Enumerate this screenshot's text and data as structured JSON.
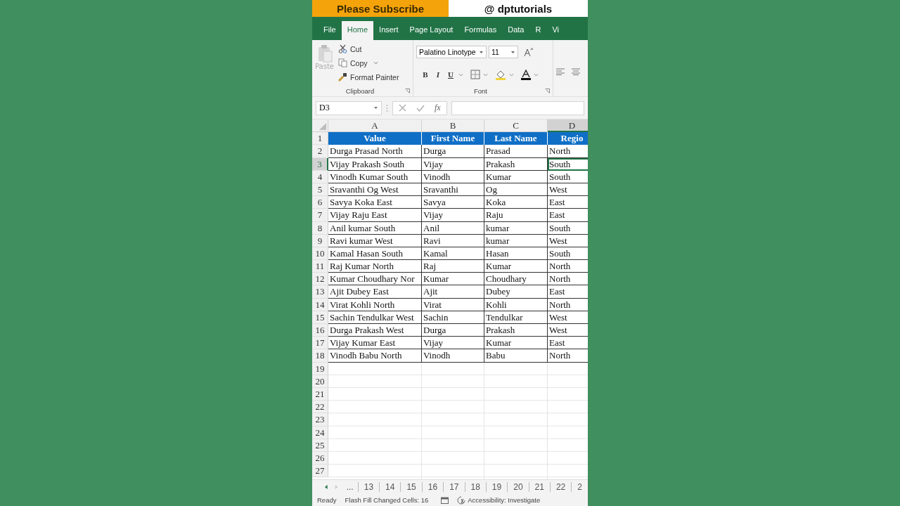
{
  "banner": {
    "left": "Please Subscribe",
    "right": "@ dptutorials"
  },
  "ribbon_tabs": [
    {
      "label": "File",
      "selected": false
    },
    {
      "label": "Home",
      "selected": true
    },
    {
      "label": "Insert",
      "selected": false
    },
    {
      "label": "Page Layout",
      "selected": false
    },
    {
      "label": "Formulas",
      "selected": false
    },
    {
      "label": "Data",
      "selected": false
    },
    {
      "label": "R",
      "selected": false
    },
    {
      "label": "Vi",
      "selected": false
    }
  ],
  "clipboard": {
    "paste": "Paste",
    "cut": "Cut",
    "copy": "Copy",
    "format_painter": "Format Painter",
    "label": "Clipboard"
  },
  "font": {
    "name": "Palatino Linotype",
    "size": "11",
    "bold": "B",
    "italic": "I",
    "underline": "U",
    "label": "Font"
  },
  "name_box": "D3",
  "formula_bar": {
    "fx": "fx"
  },
  "columns": [
    {
      "label": "A",
      "selected": false
    },
    {
      "label": "B",
      "selected": false
    },
    {
      "label": "C",
      "selected": false
    },
    {
      "label": "D",
      "selected": true
    }
  ],
  "header": {
    "number": "1",
    "cells": [
      "Value",
      "First Name",
      "Last Name",
      "Regio"
    ]
  },
  "rows": [
    {
      "number": "2",
      "selected": false,
      "cells": [
        "Durga Prasad North",
        "Durga",
        "Prasad",
        "North"
      ]
    },
    {
      "number": "3",
      "selected": true,
      "cells": [
        "Vijay Prakash South",
        "Vijay",
        "Prakash",
        "South"
      ]
    },
    {
      "number": "4",
      "selected": false,
      "cells": [
        "Vinodh Kumar South",
        "Vinodh",
        "Kumar",
        "South"
      ]
    },
    {
      "number": "5",
      "selected": false,
      "cells": [
        "Sravanthi Og West",
        "Sravanthi",
        "Og",
        "West"
      ]
    },
    {
      "number": "6",
      "selected": false,
      "cells": [
        "Savya Koka East",
        "Savya",
        "Koka",
        "East"
      ]
    },
    {
      "number": "7",
      "selected": false,
      "cells": [
        "Vijay Raju East",
        "Vijay",
        "Raju",
        "East"
      ]
    },
    {
      "number": "8",
      "selected": false,
      "cells": [
        "Anil kumar South",
        "Anil",
        "kumar",
        "South"
      ]
    },
    {
      "number": "9",
      "selected": false,
      "cells": [
        "Ravi kumar West",
        "Ravi",
        "kumar",
        "West"
      ]
    },
    {
      "number": "10",
      "selected": false,
      "cells": [
        "Kamal Hasan South",
        "Kamal",
        "Hasan",
        "South"
      ]
    },
    {
      "number": "11",
      "selected": false,
      "cells": [
        "Raj Kumar North",
        "Raj",
        "Kumar",
        "North"
      ]
    },
    {
      "number": "12",
      "selected": false,
      "cells": [
        "Kumar Choudhary Nor",
        "Kumar",
        "Choudhary",
        "North"
      ]
    },
    {
      "number": "13",
      "selected": false,
      "cells": [
        "Ajit Dubey East",
        "Ajit",
        "Dubey",
        "East"
      ]
    },
    {
      "number": "14",
      "selected": false,
      "cells": [
        "Virat Kohli North",
        "Virat",
        "Kohli",
        "North"
      ]
    },
    {
      "number": "15",
      "selected": false,
      "cells": [
        "Sachin Tendulkar West",
        "Sachin",
        "Tendulkar",
        "West"
      ]
    },
    {
      "number": "16",
      "selected": false,
      "cells": [
        "Durga Prakash West",
        "Durga",
        "Prakash",
        "West"
      ]
    },
    {
      "number": "17",
      "selected": false,
      "cells": [
        "Vijay Kumar East",
        "Vijay",
        "Kumar",
        "East"
      ]
    },
    {
      "number": "18",
      "selected": false,
      "cells": [
        "Vinodh Babu North",
        "Vinodh",
        "Babu",
        "North"
      ]
    }
  ],
  "empty_rows": [
    "19",
    "20",
    "21",
    "22",
    "23",
    "24",
    "25",
    "26",
    "27"
  ],
  "sheet_tabs": [
    "...",
    "13",
    "14",
    "15",
    "16",
    "17",
    "18",
    "19",
    "20",
    "21",
    "22",
    "2"
  ],
  "status_bar": {
    "ready": "Ready",
    "flash_fill": "Flash Fill Changed Cells: 16",
    "accessibility": "Accessibility: Investigate"
  }
}
